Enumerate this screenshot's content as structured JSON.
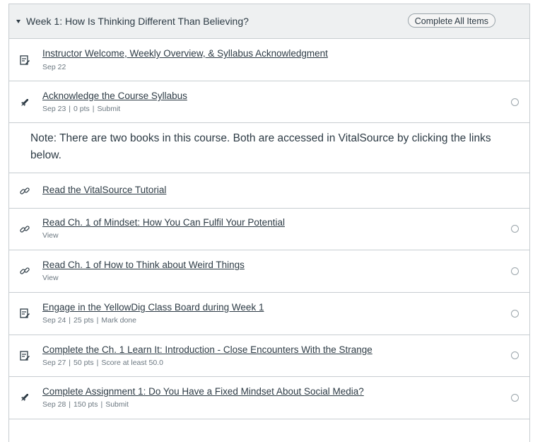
{
  "module": {
    "title": "Week 1: How Is Thinking Different Than Believing?",
    "complete_all_label": "Complete All Items"
  },
  "items": [
    {
      "type": "page",
      "icon": "page-icon",
      "title": "Instructor Welcome, Weekly Overview, & Syllabus Acknowledgment",
      "meta": [
        "Sep 22"
      ],
      "status": false
    },
    {
      "type": "assignment",
      "icon": "assignment-rocket-icon",
      "title": "Acknowledge the Course Syllabus",
      "meta": [
        "Sep 23",
        "0 pts",
        "Submit"
      ],
      "status": true
    },
    {
      "type": "note",
      "text": "Note: There are two books in this course. Both are accessed in VitalSource by clicking the links below."
    },
    {
      "type": "link",
      "icon": "link-icon",
      "title": "Read the VitalSource Tutorial",
      "meta": [],
      "status": false
    },
    {
      "type": "link",
      "icon": "link-icon",
      "title": "Read Ch. 1 of Mindset: How You Can Fulfil Your Potential",
      "meta": [
        "View"
      ],
      "status": true
    },
    {
      "type": "link",
      "icon": "link-icon",
      "title": "Read Ch. 1 of How to Think about Weird Things",
      "meta": [
        "View"
      ],
      "status": true
    },
    {
      "type": "page",
      "icon": "page-icon",
      "title": "Engage in the YellowDig Class Board during Week 1",
      "meta": [
        "Sep 24",
        "25 pts",
        "Mark done"
      ],
      "status": true
    },
    {
      "type": "page",
      "icon": "page-icon",
      "title": "Complete the Ch. 1 Learn It: Introduction - Close Encounters With the Strange",
      "meta": [
        "Sep 27",
        "50 pts",
        "Score at least 50.0"
      ],
      "status": true
    },
    {
      "type": "assignment",
      "icon": "assignment-rocket-icon",
      "title": "Complete Assignment 1: Do You Have a Fixed Mindset About Social Media?",
      "meta": [
        "Sep 28",
        "150 pts",
        "Submit"
      ],
      "status": true
    }
  ]
}
